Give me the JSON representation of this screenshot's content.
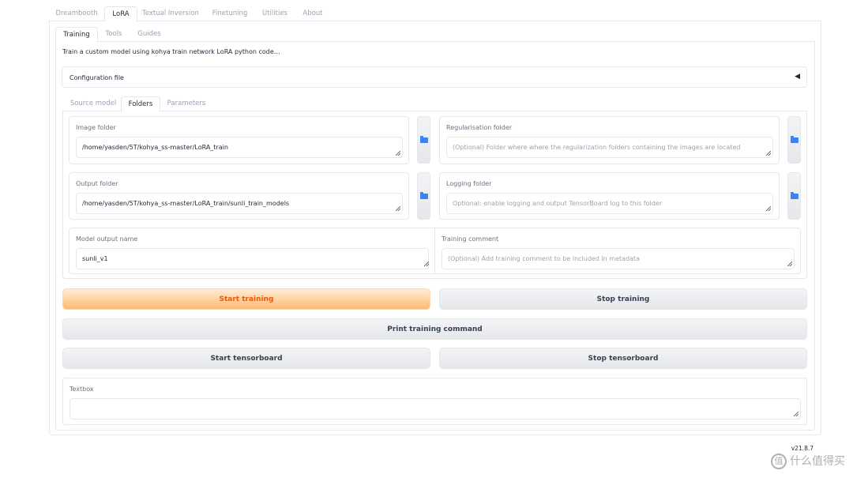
{
  "tabs": [
    "Dreambooth",
    "LoRA",
    "Textual Inversion",
    "Finetuning",
    "Utilities",
    "About"
  ],
  "subtabs": [
    "Training",
    "Tools",
    "Guides"
  ],
  "description": "Train a custom model using kohya train network LoRA python code…",
  "config_accordion": {
    "label": "Configuration file",
    "arrow": "◀"
  },
  "section_tabs": [
    "Source model",
    "Folders",
    "Parameters"
  ],
  "fields": {
    "image_folder": {
      "label": "Image folder",
      "value": "/home/yasden/5T/kohya_ss-master/LoRA_train"
    },
    "reg_folder": {
      "label": "Regularisation folder",
      "placeholder": "(Optional) Folder where where the regularization folders containing the images are located"
    },
    "output_folder": {
      "label": "Output folder",
      "value": "/home/yasden/5T/kohya_ss-master/LoRA_train/sunli_train_models"
    },
    "logging_folder": {
      "label": "Logging folder",
      "placeholder": "Optional: enable logging and output TensorBoard log to this folder"
    },
    "model_output_name": {
      "label": "Model output name",
      "value": "sunli_v1"
    },
    "training_comment": {
      "label": "Training comment",
      "placeholder": "(Optional) Add training comment to be included in metadata"
    }
  },
  "buttons": {
    "start_training": "Start training",
    "stop_training": "Stop training",
    "print_command": "Print training command",
    "start_tensorboard": "Start tensorboard",
    "stop_tensorboard": "Stop tensorboard"
  },
  "textbox": {
    "label": "Textbox",
    "value": ""
  },
  "version": "v21.8.7",
  "watermark": {
    "logo": "值",
    "text": "什么值得买"
  },
  "colors": {
    "accent": "#ea580c",
    "folder_icon": "#3b82f6"
  }
}
